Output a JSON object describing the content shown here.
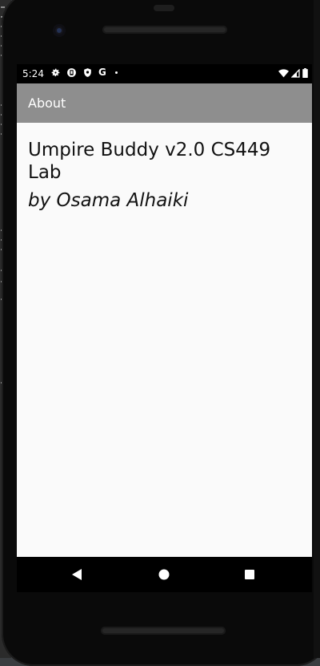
{
  "status_bar": {
    "time": "5:24",
    "left_icons": [
      "settings-icon",
      "notification-icon",
      "shield-icon",
      "google-icon",
      "dot-icon"
    ],
    "google_letter": "G",
    "right_icons": [
      "wifi-icon",
      "signal-icon",
      "battery-icon"
    ]
  },
  "app_bar": {
    "title": "About"
  },
  "about": {
    "title": "Umpire Buddy v2.0 CS449 Lab",
    "author": "by Osama Alhaiki"
  },
  "nav_bar": {
    "buttons": [
      "back-icon",
      "home-icon",
      "recents-icon"
    ]
  },
  "colors": {
    "app_bar": "#8e8e8e",
    "content_background": "#fafafa",
    "text": "#111111",
    "phone_frame": "#0a0a0a"
  }
}
